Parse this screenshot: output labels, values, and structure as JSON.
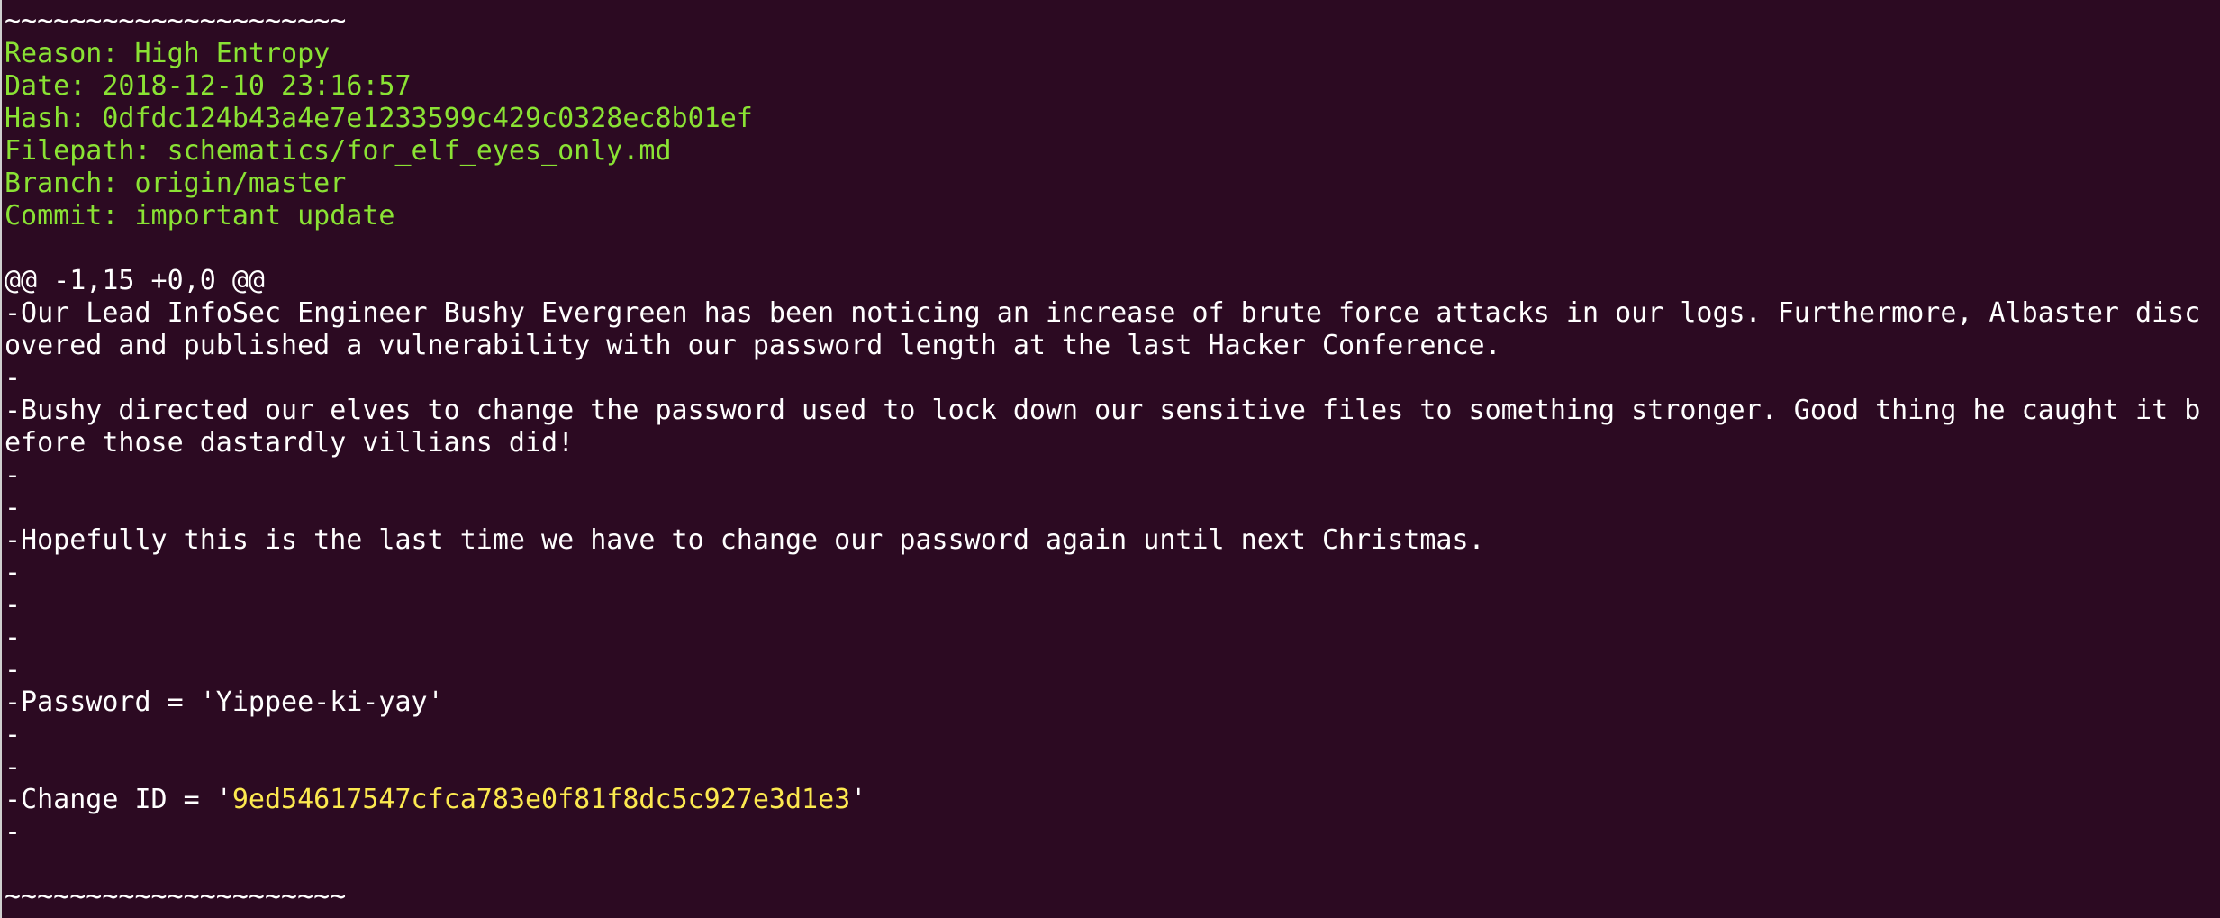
{
  "terminal": {
    "top_divider": "~~~~~~~~~~~~~~~~~~~~~",
    "meta": {
      "reason": "Reason: High Entropy",
      "date": "Date: 2018-12-10 23:16:57",
      "hash": "Hash: 0dfdc124b43a4e7e1233599c429c0328ec8b01ef",
      "filepath": "Filepath: schematics/for_elf_eyes_only.md",
      "branch": "Branch: origin/master",
      "commit": "Commit: important update"
    },
    "diff": {
      "hunk_header": "@@ -1,15 +0,0 @@",
      "l1a": "-Our Lead InfoSec Engineer Bushy Evergreen has been noticing an increase of brute force attacks in our logs. Furthermore, Albaster disc",
      "l1b": "overed and published a vulnerability with our password length at the last Hacker Conference.",
      "l2": "-",
      "l3a": "-Bushy directed our elves to change the password used to lock down our sensitive files to something stronger. Good thing he caught it b",
      "l3b": "efore those dastardly villians did!",
      "l4": "-",
      "l5": "-",
      "l6": "-Hopefully this is the last time we have to change our password again until next Christmas.",
      "l7": "-",
      "l8": "-",
      "l9": "-",
      "l10": "-",
      "password": "-Password = 'Yippee-ki-yay'",
      "l11": "-",
      "l12": "-",
      "change_prefix": "-Change ID = '",
      "change_id": "9ed54617547cfca783e0f81f8dc5c927e3d1e3",
      "change_suffix": "'",
      "l13": "-"
    },
    "bottom_divider": "~~~~~~~~~~~~~~~~~~~~~",
    "colors": {
      "background": "#2c0a22",
      "meta_text": "#8ae234",
      "body_text": "#ffffff",
      "highlight": "#fce94f"
    }
  }
}
